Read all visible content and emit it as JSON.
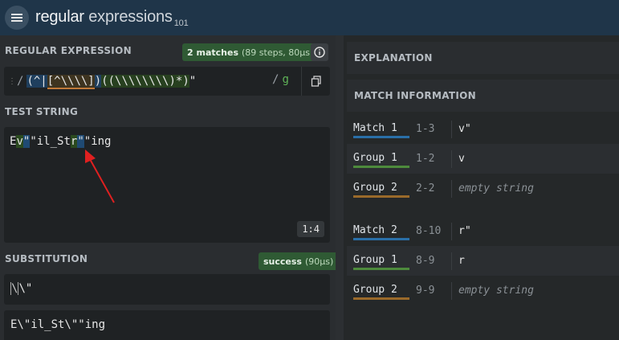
{
  "header": {
    "brand_a": "regular",
    "brand_b": " expressions",
    "brand_sub": "101"
  },
  "regex": {
    "title": "REGULAR EXPRESSION",
    "matches_count": "2 matches",
    "matches_detail": "(89 steps, 80µs)",
    "delimiter": "/",
    "pattern_g1_open": "(^|",
    "pattern_class": "[^\\\\\\\\]",
    "pattern_g1_close": ")",
    "pattern_g2": "((\\\\\\\\\\\\\\\\)*)",
    "pattern_tail": "\"",
    "flags": "g"
  },
  "test_string": {
    "title": "TEST STRING",
    "p1": "E",
    "p2": "v",
    "p3": "\"il_St",
    "p4": "r",
    "p5": "\"",
    "p6": "\"ing",
    "cursor": "1:4"
  },
  "substitution": {
    "title": "SUBSTITUTION",
    "status": "success",
    "status_detail": "(90µs)",
    "escape": "\\",
    "value_rest": "\\\"",
    "result": "E\\\"il_St\\\"\"ing"
  },
  "explanation": {
    "title": "EXPLANATION"
  },
  "match_info": {
    "title": "MATCH INFORMATION",
    "rows": [
      {
        "label": "Match 1",
        "range": "1-3",
        "value": "v\""
      },
      {
        "label": "Group 1",
        "range": "1-2",
        "value": "v"
      },
      {
        "label": "Group 2",
        "range": "2-2",
        "value": "empty string"
      },
      {
        "label": "Match 2",
        "range": "8-10",
        "value": "r\""
      },
      {
        "label": "Group 1",
        "range": "8-9",
        "value": "r"
      },
      {
        "label": "Group 2",
        "range": "9-9",
        "value": "empty string"
      }
    ]
  },
  "colors": {
    "match": "#2a6fa8",
    "group1": "#4d8a3c",
    "group2": "#9a6a2a",
    "arrow": "#e02020"
  }
}
